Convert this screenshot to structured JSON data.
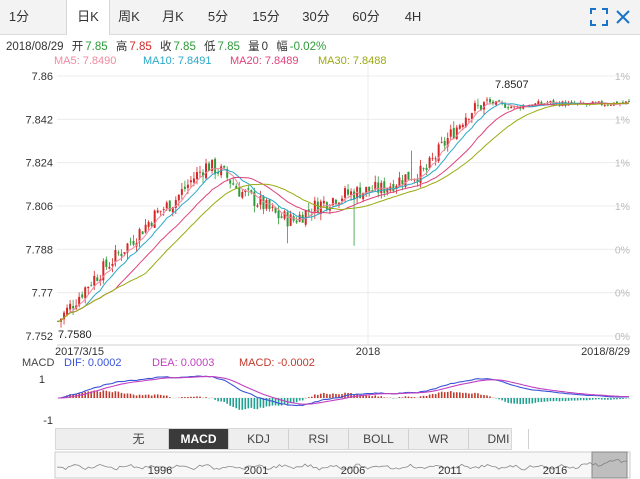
{
  "tabs": [
    "1分",
    "日K",
    "周K",
    "月K",
    "5分",
    "15分",
    "30分",
    "60分",
    "4H"
  ],
  "active_tab": 1,
  "info": {
    "date": "2018/08/29",
    "open_label": "开",
    "open": "7.85",
    "high_label": "高",
    "high": "7.85",
    "close_label": "收",
    "close": "7.85",
    "low_label": "低",
    "low": "7.85",
    "vol_label": "量",
    "vol": "0",
    "chg_label": "幅",
    "chg": "-0.02%"
  },
  "ma": [
    {
      "label": "MA5: 7.8490",
      "color": "#f08aa0"
    },
    {
      "label": "MA10: 7.8491",
      "color": "#2aa8c8"
    },
    {
      "label": "MA20: 7.8489",
      "color": "#e0407a"
    },
    {
      "label": "MA30: 7.8488",
      "color": "#9aaa10"
    }
  ],
  "macd_legend": {
    "title": "MACD",
    "dif": "DIF: 0.0002",
    "dea": "DEA: 0.0003",
    "macd": "MACD: -0.0002"
  },
  "indicators": [
    "无",
    "MACD",
    "KDJ",
    "RSI",
    "BOLL",
    "WR",
    "DMI"
  ],
  "active_indicator": 1,
  "nav_buttons": [
    "▲",
    "▼"
  ],
  "navigator_years": [
    "1996",
    "2001",
    "2006",
    "2011",
    "2016"
  ],
  "colors": {
    "up": "#d62728",
    "down": "#2e9b3a",
    "dif": "#3a55d8",
    "dea": "#c040c0",
    "macd_pos": "#c0392b",
    "macd_neg": "#20a090"
  },
  "chart_data": {
    "type": "candlestick",
    "title": "",
    "y_ticks": [
      "7.86",
      "7.842",
      "7.824",
      "7.806",
      "7.788",
      "7.77",
      "7.752"
    ],
    "ylim": [
      7.752,
      7.86
    ],
    "right_ticks": [
      "1%",
      "1%",
      "1%",
      "1%",
      "0%",
      "0%",
      "0%"
    ],
    "x_labels": [
      "2017/3/15",
      "2018",
      "2018/8/29"
    ],
    "annotations": {
      "max": "7.8507",
      "min": "7.7580"
    },
    "trend": [
      [
        "2017-03-15",
        7.758
      ],
      [
        "2017-04-15",
        7.775
      ],
      [
        "2017-05-15",
        7.788
      ],
      [
        "2017-06-15",
        7.803
      ],
      [
        "2017-07-01",
        7.808
      ],
      [
        "2017-07-20",
        7.818
      ],
      [
        "2017-08-01",
        7.823
      ],
      [
        "2017-08-15",
        7.82
      ],
      [
        "2017-09-01",
        7.812
      ],
      [
        "2017-09-20",
        7.807
      ],
      [
        "2017-10-05",
        7.802
      ],
      [
        "2017-10-20",
        7.8
      ],
      [
        "2017-11-10",
        7.806
      ],
      [
        "2017-12-01",
        7.81
      ],
      [
        "2017-12-20",
        7.812
      ],
      [
        "2018-01-10",
        7.813
      ],
      [
        "2018-02-01",
        7.818
      ],
      [
        "2018-02-20",
        7.82
      ],
      [
        "2018-03-10",
        7.832
      ],
      [
        "2018-04-01",
        7.845
      ],
      [
        "2018-04-20",
        7.849
      ],
      [
        "2018-05-15",
        7.847
      ],
      [
        "2018-06-15",
        7.849
      ],
      [
        "2018-07-15",
        7.848
      ],
      [
        "2018-08-29",
        7.849
      ]
    ]
  }
}
